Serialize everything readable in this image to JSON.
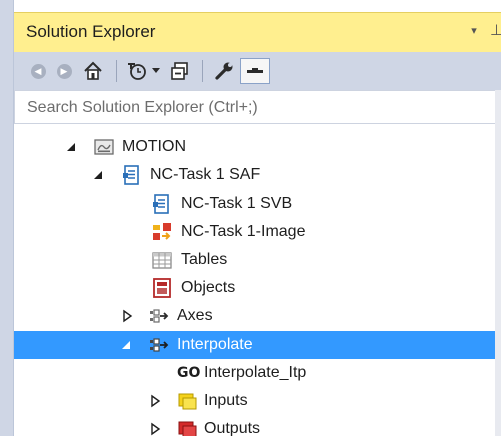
{
  "panel": {
    "title": "Solution Explorer",
    "dropdown_icon": "▾",
    "pin_icon": "⊥"
  },
  "toolbar": {
    "icons": [
      "back-icon",
      "forward-icon",
      "home-icon",
      "history-icon",
      "collapse-all-icon",
      "properties-icon",
      "preview-icon"
    ]
  },
  "search": {
    "placeholder": "Search Solution Explorer (Ctrl+;)"
  },
  "tree": {
    "items": [
      {
        "label": "MOTION",
        "expanded": true,
        "icon": "motion-icon"
      },
      {
        "label": "NC-Task 1 SAF",
        "expanded": true,
        "icon": "nc-task-icon"
      },
      {
        "label": "NC-Task 1 SVB",
        "icon": "nc-task-icon"
      },
      {
        "label": "NC-Task 1-Image",
        "icon": "image-icon"
      },
      {
        "label": "Tables",
        "icon": "table-icon"
      },
      {
        "label": "Objects",
        "icon": "objects-icon"
      },
      {
        "label": "Axes",
        "expanded": false,
        "icon": "axes-icon"
      },
      {
        "label": "Interpolate",
        "expanded": true,
        "selected": true,
        "icon": "axes-icon"
      },
      {
        "label": "Interpolate_Itp",
        "prefix": "GO",
        "icon": "go-icon"
      },
      {
        "label": "Inputs",
        "expanded": false,
        "icon": "inputs-icon"
      },
      {
        "label": "Outputs",
        "expanded": false,
        "icon": "outputs-icon"
      }
    ]
  },
  "colors": {
    "title_bar": "#ffef8f",
    "toolbar": "#cfd6e5",
    "selection": "#3399ff"
  }
}
